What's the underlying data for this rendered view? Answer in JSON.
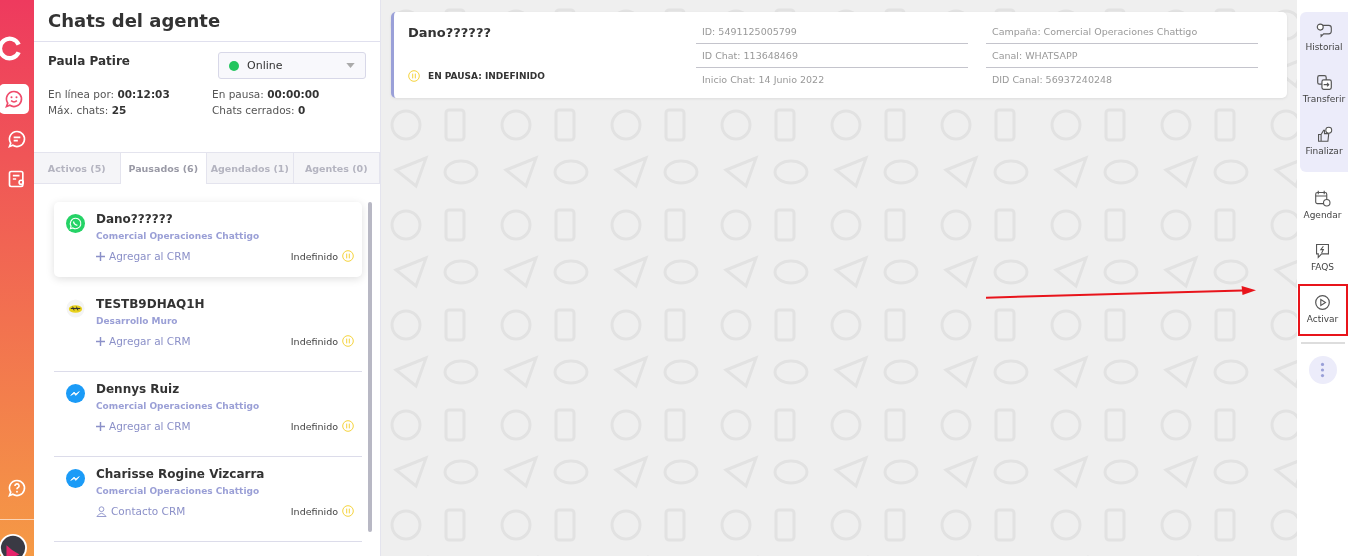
{
  "panel": {
    "title": "Chats del agente"
  },
  "agent": {
    "name": "Paula Patire",
    "status": {
      "label": "Online",
      "color": "#22c55e"
    },
    "stats": [
      {
        "label": "En línea por:",
        "value": "00:12:03"
      },
      {
        "label": "En pausa:",
        "value": "00:00:00"
      },
      {
        "label": "Máx. chats:",
        "value": "25"
      },
      {
        "label": "Chats cerrados:",
        "value": "0"
      }
    ]
  },
  "tabs": [
    {
      "label": "Activos (5)",
      "selected": false
    },
    {
      "label": "Pausados (6)",
      "selected": true
    },
    {
      "label": "Agendados (1)",
      "selected": false
    },
    {
      "label": "Agentes (0)",
      "selected": false
    }
  ],
  "chats": [
    {
      "name": "Dano??????",
      "campaign": "Comercial Operaciones Chattigo",
      "kind": "whatsapp",
      "action": {
        "kind": "add",
        "label": "Agregar al CRM"
      },
      "pause": "Indefinido",
      "selected": true
    },
    {
      "name": "TESTB9DHAQ1H",
      "campaign": "Desarrollo Muro",
      "kind": "custom",
      "action": {
        "kind": "add",
        "label": "Agregar al CRM"
      },
      "pause": "Indefinido",
      "selected": false
    },
    {
      "name": "Dennys Ruiz",
      "campaign": "Comercial Operaciones Chattigo",
      "kind": "messenger",
      "action": {
        "kind": "add",
        "label": "Agregar al CRM"
      },
      "pause": "Indefinido",
      "selected": false
    },
    {
      "name": "Charisse Rogine Vizcarra",
      "campaign": "Comercial Operaciones Chattigo",
      "kind": "messenger",
      "action": {
        "kind": "contact",
        "label": "Contacto CRM"
      },
      "pause": "Indefinido",
      "selected": false
    }
  ],
  "chat_header": {
    "name": "Dano??????",
    "status": "EN PAUSA: INDEFINIDO",
    "details": [
      [
        "ID: 5491125005799",
        "ID Chat: 113648469",
        "Inicio Chat: 14 Junio 2022"
      ],
      [
        "Campaña: Comercial Operaciones Chattigo",
        "Canal: WHATSAPP",
        "DID Canal: 56937240248"
      ]
    ]
  },
  "actions": [
    {
      "kind": "history",
      "label": "Historial",
      "grouped": true,
      "highlighted": false
    },
    {
      "kind": "transfer",
      "label": "Transferir",
      "grouped": true,
      "highlighted": false
    },
    {
      "kind": "finish",
      "label": "Finalizar",
      "grouped": true,
      "highlighted": false
    },
    {
      "kind": "schedule",
      "label": "Agendar",
      "grouped": false,
      "highlighted": false
    },
    {
      "kind": "faq",
      "label": "FAQS",
      "grouped": false,
      "highlighted": false
    },
    {
      "kind": "play",
      "label": "Activar",
      "grouped": false,
      "highlighted": true
    }
  ]
}
